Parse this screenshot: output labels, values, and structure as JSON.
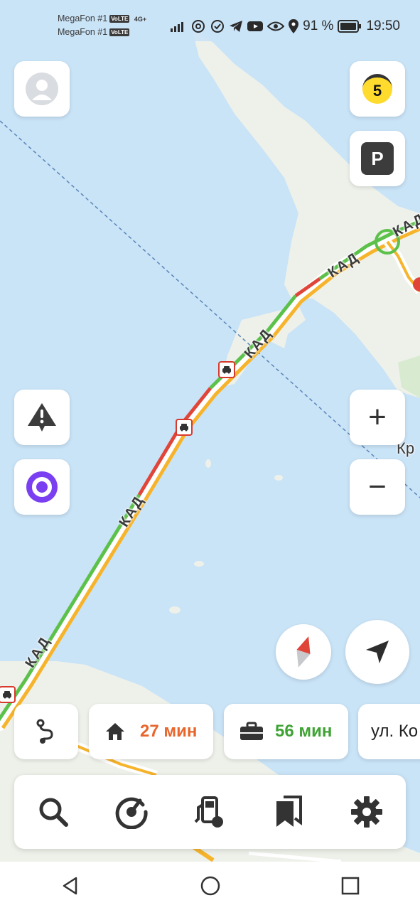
{
  "status_bar": {
    "carrier1": "MegaFon #1",
    "carrier2": "MegaFon #1",
    "volte": "VoLTE",
    "network": "4G+",
    "battery_percent": "91 %",
    "time": "19:50"
  },
  "map": {
    "road_label": "КАД",
    "place_label": "Кр",
    "traffic_colors": {
      "heavy": "#e0453a",
      "medium": "#f6b42c",
      "free": "#5cc14a"
    },
    "water_color": "#c9e3f7",
    "land_color": "#eef1ea"
  },
  "buttons": {
    "traffic_level": "5",
    "parking": "P",
    "zoom_in": "+",
    "zoom_out": "−"
  },
  "quick_chips": {
    "home_time": "27 мин",
    "work_time": "56 мин",
    "street": "ул. Ко"
  },
  "tab_bar": {
    "icons": [
      "search-icon",
      "history-icon",
      "fuel-icon",
      "bookmarks-icon",
      "settings-icon"
    ]
  },
  "colors": {
    "accent_orange": "#e8662c",
    "accent_green": "#3fa334",
    "alice_purple": "#7b3ff2",
    "traffic_yellow": "#ffdb2e"
  }
}
